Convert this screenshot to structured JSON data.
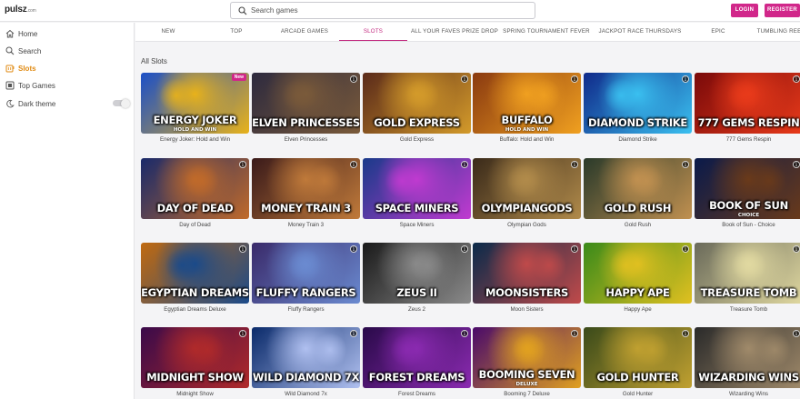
{
  "brand": {
    "logo_text": "pulsz",
    "logo_suffix": ".com"
  },
  "search": {
    "placeholder": "Search games"
  },
  "auth": {
    "login_label": "LOGIN",
    "register_label": "REGISTER",
    "accent_color": "#d1278a"
  },
  "sidebar": {
    "items": [
      {
        "label": "Home",
        "icon": "home-icon"
      },
      {
        "label": "Search",
        "icon": "search-icon"
      },
      {
        "label": "Slots",
        "icon": "slot-machine-icon",
        "active": true
      },
      {
        "label": "Top Games",
        "icon": "top-games-icon"
      },
      {
        "label": "Dark theme",
        "icon": "moon-icon",
        "toggle": false
      }
    ]
  },
  "tabs": [
    {
      "label": "NEW"
    },
    {
      "label": "TOP"
    },
    {
      "label": "ARCADE GAMES"
    },
    {
      "label": "SLOTS",
      "active": true
    },
    {
      "label": "ALL YOUR FAVES PRIZE DROP"
    },
    {
      "label": "SPRING TOURNAMENT FEVER"
    },
    {
      "label": "JACKPOT RACE THURSDAYS"
    },
    {
      "label": "EPIC"
    },
    {
      "label": "TUMBLING REELS"
    }
  ],
  "section": {
    "title": "All Slots"
  },
  "games": [
    {
      "name": "Energy Joker: Hold and Win",
      "art_title": "ENERGY JOKER",
      "art_sub": "HOLD AND WIN",
      "badge": "New",
      "colors": [
        "#1b4fc7",
        "#e8b21a"
      ]
    },
    {
      "name": "Elven Princesses",
      "art_title": "ELVEN PRINCESSES",
      "colors": [
        "#2d2a3e",
        "#7a5a3a"
      ]
    },
    {
      "name": "Gold Express",
      "art_title": "GOLD EXPRESS",
      "colors": [
        "#5a2a1a",
        "#d39a2a"
      ]
    },
    {
      "name": "Buffalo: Hold and Win",
      "art_title": "BUFFALO",
      "art_sub": "HOLD AND WIN",
      "colors": [
        "#8a3a10",
        "#f0a020"
      ]
    },
    {
      "name": "Diamond Strike",
      "art_title": "DIAMOND STRIKE",
      "colors": [
        "#102a8a",
        "#3ac0f0"
      ]
    },
    {
      "name": "777 Gems Respin",
      "art_title": "777 GEMS RESPIN",
      "colors": [
        "#7a0a0a",
        "#e83a1a"
      ]
    },
    {
      "name": "Day of Dead",
      "art_title": "DAY OF DEAD",
      "colors": [
        "#1a2a6a",
        "#c06a2a"
      ]
    },
    {
      "name": "Money Train 3",
      "art_title": "MONEY TRAIN 3",
      "colors": [
        "#3a1a1a",
        "#c07a3a"
      ]
    },
    {
      "name": "Space Miners",
      "art_title": "SPACE MINERS",
      "colors": [
        "#1a3a8a",
        "#c03ad0"
      ]
    },
    {
      "name": "Olympian Gods",
      "art_title": "OLYMPIANGODS",
      "colors": [
        "#3a2a1a",
        "#b08a4a"
      ]
    },
    {
      "name": "Gold Rush",
      "art_title": "GOLD RUSH",
      "colors": [
        "#2a3a2a",
        "#c09050"
      ]
    },
    {
      "name": "Book of Sun - Choice",
      "art_title": "BOOK OF SUN",
      "art_sub": "CHOICE",
      "colors": [
        "#0a1a4a",
        "#6a3a1a"
      ]
    },
    {
      "name": "Egyptian Dreams Deluxe",
      "art_title": "EGYPTIAN DREAMS",
      "colors": [
        "#c06a10",
        "#1a4a8a"
      ]
    },
    {
      "name": "Fluffy Rangers",
      "art_title": "FLUFFY RANGERS",
      "colors": [
        "#3a2a6a",
        "#6a8ad0"
      ]
    },
    {
      "name": "Zeus 2",
      "art_title": "ZEUS II",
      "colors": [
        "#1a1a1a",
        "#8a8a8a"
      ]
    },
    {
      "name": "Moon Sisters",
      "art_title": "MOONSISTERS",
      "colors": [
        "#0a2a4a",
        "#c04a4a"
      ]
    },
    {
      "name": "Happy Ape",
      "art_title": "HAPPY APE",
      "colors": [
        "#3a8a1a",
        "#e0c020"
      ]
    },
    {
      "name": "Treasure Tomb",
      "art_title": "TREASURE TOMB",
      "colors": [
        "#6a6a5a",
        "#e0d8a0"
      ]
    },
    {
      "name": "Midnight Show",
      "art_title": "MIDNIGHT SHOW",
      "colors": [
        "#3a0a4a",
        "#b02a2a"
      ]
    },
    {
      "name": "Wild Diamond 7x",
      "art_title": "WILD DIAMOND 7X",
      "colors": [
        "#0a2a6a",
        "#b0c0f0"
      ]
    },
    {
      "name": "Forest Dreams",
      "art_title": "FOREST DREAMS",
      "colors": [
        "#2a0a4a",
        "#8a2ab0"
      ]
    },
    {
      "name": "Booming 7 Deluxe",
      "art_title": "BOOMING SEVEN",
      "art_sub": "DELUXE",
      "colors": [
        "#4a0a6a",
        "#e0a020"
      ]
    },
    {
      "name": "Gold Hunter",
      "art_title": "GOLD HUNTER",
      "colors": [
        "#3a4a1a",
        "#c0a030"
      ]
    },
    {
      "name": "Wizarding Wins",
      "art_title": "WIZARDING WINS",
      "colors": [
        "#2a2a2a",
        "#a08a6a"
      ]
    }
  ]
}
